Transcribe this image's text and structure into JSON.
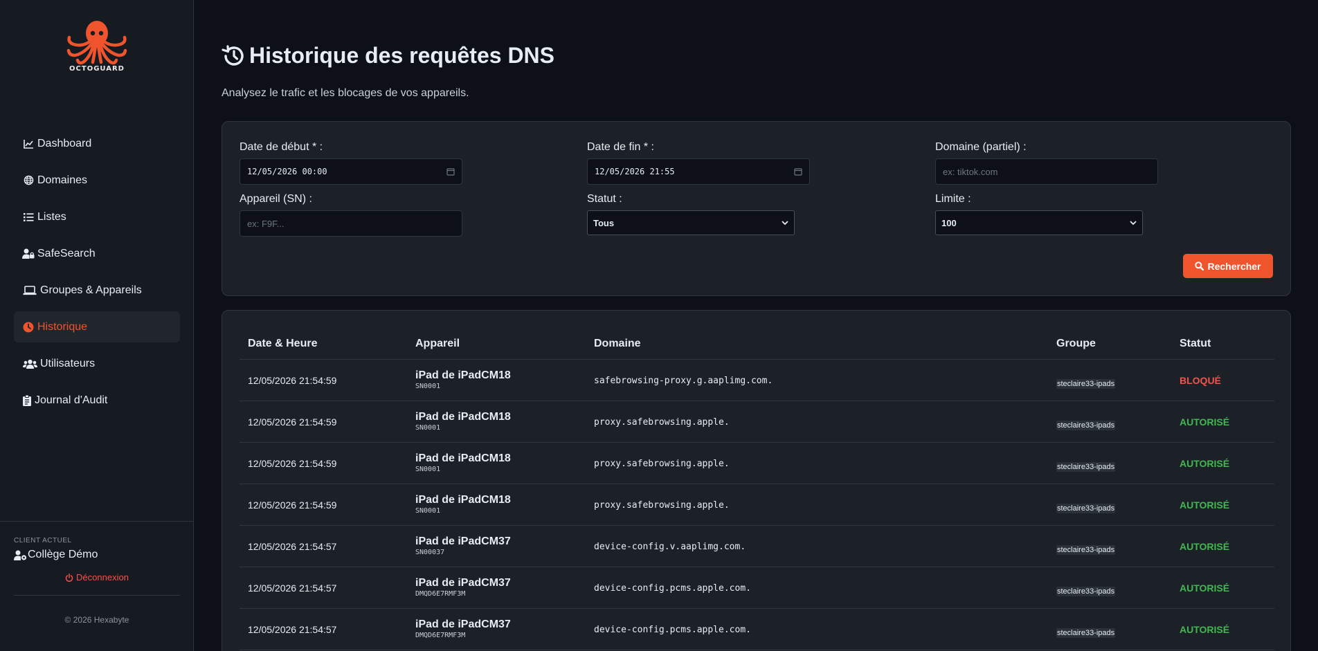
{
  "brand": {
    "name": "OCTOGUARD"
  },
  "nav": [
    {
      "label": "Dashboard",
      "icon": "chart-line-icon"
    },
    {
      "label": "Domaines",
      "icon": "globe-icon"
    },
    {
      "label": "Listes",
      "icon": "list-icon"
    },
    {
      "label": "SafeSearch",
      "icon": "user-lock-icon"
    },
    {
      "label": "Groupes & Appareils",
      "icon": "laptop-icon"
    },
    {
      "label": "Historique",
      "icon": "clock-icon",
      "active": true
    },
    {
      "label": "Utilisateurs",
      "icon": "users-icon"
    },
    {
      "label": "Journal d'Audit",
      "icon": "clipboard-icon"
    }
  ],
  "client": {
    "label": "CLIENT ACTUEL",
    "name": "Collège Démo"
  },
  "logout_label": "Déconnexion",
  "copyright": "© 2026 Hexabyte",
  "page": {
    "title": "Historique des requêtes DNS",
    "subtitle": "Analysez le trafic et les blocages de vos appareils."
  },
  "filters": {
    "start_label": "Date de début * :",
    "start_value": "12/05/2026 00:00",
    "end_label": "Date de fin * :",
    "end_value": "12/05/2026 21:55",
    "domain_label": "Domaine (partiel) :",
    "domain_placeholder": "ex: tiktok.com",
    "device_label": "Appareil (SN) :",
    "device_placeholder": "ex: F9F...",
    "status_label": "Statut :",
    "status_value": "Tous",
    "limit_label": "Limite :",
    "limit_value": "100",
    "search_label": "Rechercher"
  },
  "table": {
    "headers": [
      "Date & Heure",
      "Appareil",
      "Domaine",
      "Groupe",
      "Statut"
    ],
    "rows": [
      {
        "date": "12/05/2026 21:54:59",
        "device": "iPad de iPadCM18",
        "sn": "SN0001",
        "domain": "safebrowsing-proxy.g.aaplimg.com.",
        "group": "steclaire33-ipads",
        "status": "BLOQUÉ",
        "blocked": true
      },
      {
        "date": "12/05/2026 21:54:59",
        "device": "iPad de iPadCM18",
        "sn": "SN0001",
        "domain": "proxy.safebrowsing.apple.",
        "group": "steclaire33-ipads",
        "status": "AUTORISÉ",
        "blocked": false
      },
      {
        "date": "12/05/2026 21:54:59",
        "device": "iPad de iPadCM18",
        "sn": "SN0001",
        "domain": "proxy.safebrowsing.apple.",
        "group": "steclaire33-ipads",
        "status": "AUTORISÉ",
        "blocked": false
      },
      {
        "date": "12/05/2026 21:54:59",
        "device": "iPad de iPadCM18",
        "sn": "SN0001",
        "domain": "proxy.safebrowsing.apple.",
        "group": "steclaire33-ipads",
        "status": "AUTORISÉ",
        "blocked": false
      },
      {
        "date": "12/05/2026 21:54:57",
        "device": "iPad de iPadCM37",
        "sn": "SN00037",
        "domain": "device-config.v.aaplimg.com.",
        "group": "steclaire33-ipads",
        "status": "AUTORISÉ",
        "blocked": false
      },
      {
        "date": "12/05/2026 21:54:57",
        "device": "iPad de iPadCM37",
        "sn": "DMQD6E7RMF3M",
        "domain": "device-config.pcms.apple.com.",
        "group": "steclaire33-ipads",
        "status": "AUTORISÉ",
        "blocked": false
      },
      {
        "date": "12/05/2026 21:54:57",
        "device": "iPad de iPadCM37",
        "sn": "DMQD6E7RMF3M",
        "domain": "device-config.pcms.apple.com.",
        "group": "steclaire33-ipads",
        "status": "AUTORISÉ",
        "blocked": false
      }
    ]
  },
  "colors": {
    "accent": "#f0542d",
    "blocked": "#f85149",
    "allowed": "#3fb950"
  }
}
